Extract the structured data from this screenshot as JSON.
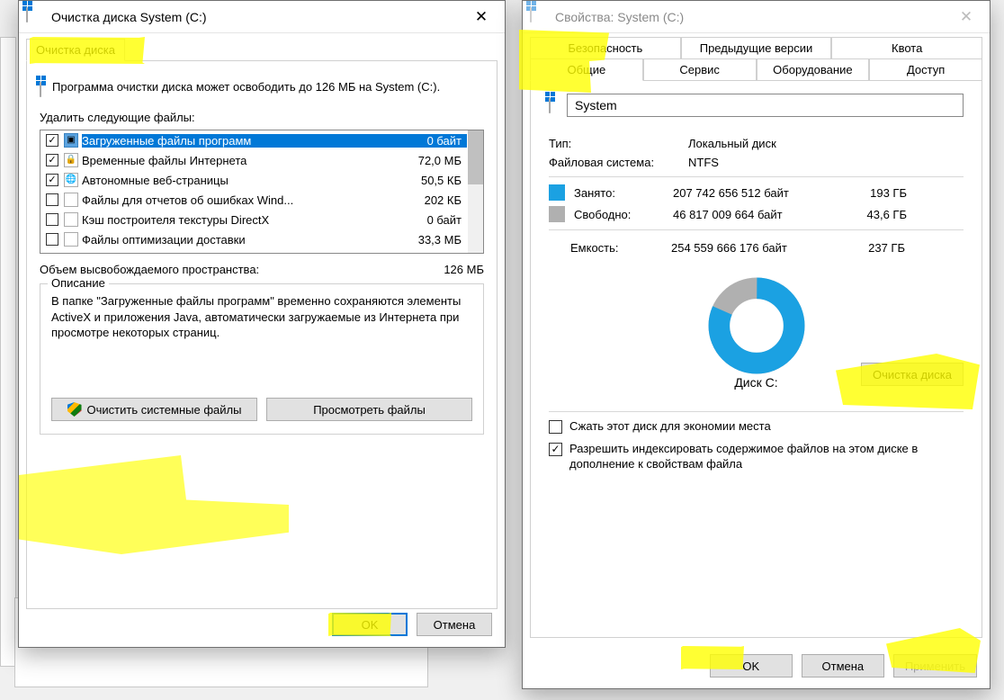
{
  "cleanup": {
    "title": "Очистка диска System (C:)",
    "tab": "Очистка диска",
    "summary": "Программа очистки диска может освободить до 126 МБ на System (C:).",
    "delete_label": "Удалить следующие файлы:",
    "items": [
      {
        "name": "Загруженные файлы программ",
        "size": "0 байт",
        "checked": true,
        "selected": true,
        "icon": "folder"
      },
      {
        "name": "Временные файлы Интернета",
        "size": "72,0 МБ",
        "checked": true,
        "selected": false,
        "icon": "lock"
      },
      {
        "name": "Автономные веб-страницы",
        "size": "50,5 КБ",
        "checked": true,
        "selected": false,
        "icon": "globe"
      },
      {
        "name": "Файлы для отчетов об ошибках Wind...",
        "size": "202 КБ",
        "checked": false,
        "selected": false,
        "icon": "file"
      },
      {
        "name": "Кэш построителя текстуры DirectX",
        "size": "0 байт",
        "checked": false,
        "selected": false,
        "icon": "file"
      },
      {
        "name": "Файлы оптимизации доставки",
        "size": "33,3 МБ",
        "checked": false,
        "selected": false,
        "icon": "file"
      }
    ],
    "total_label": "Объем высвобождаемого пространства:",
    "total_value": "126 МБ",
    "desc_legend": "Описание",
    "desc_text": "В папке \"Загруженные файлы программ\" временно сохраняются элементы ActiveX и приложения Java, автоматически загружаемые из Интернета при просмотре некоторых страниц.",
    "btn_system": "Очистить системные файлы",
    "btn_view": "Просмотреть файлы",
    "btn_ok": "OK",
    "btn_cancel": "Отмена"
  },
  "props": {
    "title": "Свойства: System (C:)",
    "tabs_row1": [
      "Безопасность",
      "Предыдущие версии",
      "Квота"
    ],
    "tabs_row2": [
      "Общие",
      "Сервис",
      "Оборудование",
      "Доступ"
    ],
    "active_tab": "Общие",
    "name": "System",
    "type_label": "Тип:",
    "type_value": "Локальный диск",
    "fs_label": "Файловая система:",
    "fs_value": "NTFS",
    "used_label": "Занято:",
    "used_bytes": "207 742 656 512 байт",
    "used_h": "193 ГБ",
    "free_label": "Свободно:",
    "free_bytes": "46 817 009 664 байт",
    "free_h": "43,6 ГБ",
    "cap_label": "Емкость:",
    "cap_bytes": "254 559 666 176 байт",
    "cap_h": "237 ГБ",
    "disk_label": "Диск C:",
    "btn_cleanup": "Очистка диска",
    "chk_compress": "Сжать этот диск для экономии места",
    "chk_index": "Разрешить индексировать содержимое файлов на этом диске в дополнение к свойствам файла",
    "btn_ok": "OK",
    "btn_cancel": "Отмена",
    "btn_apply": "Применить"
  },
  "chart_data": {
    "type": "pie",
    "title": "Диск C:",
    "series": [
      {
        "name": "Занято",
        "value": 207742656512,
        "human": "193 ГБ",
        "color": "#1ba1e2"
      },
      {
        "name": "Свободно",
        "value": 46817009664,
        "human": "43,6 ГБ",
        "color": "#b0b0b0"
      }
    ],
    "total": {
      "value": 254559666176,
      "human": "237 ГБ"
    }
  }
}
